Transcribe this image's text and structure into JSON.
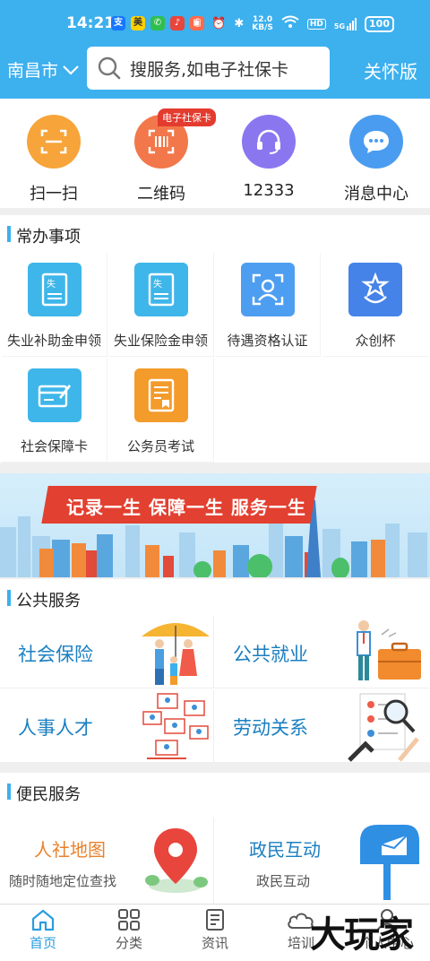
{
  "status_bar": {
    "time": "14:21",
    "speed_value": "12.0",
    "speed_unit": "KB/S",
    "hd": "HD",
    "network": "5G",
    "battery": "100"
  },
  "header": {
    "city": "南昌市",
    "search_placeholder": "搜服务,如电子社保卡",
    "care_mode": "关怀版",
    "accent_color": "#3db0ee"
  },
  "quick_actions": [
    {
      "label": "扫一扫",
      "icon": "scan-icon"
    },
    {
      "label": "二维码",
      "icon": "qrcode-icon",
      "badge": "电子社保卡"
    },
    {
      "label": "12333",
      "icon": "headset-icon"
    },
    {
      "label": "消息中心",
      "icon": "message-icon"
    }
  ],
  "common": {
    "title": "常办事项",
    "items": [
      {
        "label": "失业补助金申领",
        "icon": "unemployment-doc-icon"
      },
      {
        "label": "失业保险金申领",
        "icon": "unemployment-doc-icon"
      },
      {
        "label": "待遇资格认证",
        "icon": "face-verify-icon"
      },
      {
        "label": "众创杯",
        "icon": "trophy-logo-icon"
      },
      {
        "label": "社会保障卡",
        "icon": "social-card-icon"
      },
      {
        "label": "公务员考试",
        "icon": "exam-icon"
      }
    ]
  },
  "banner": {
    "text": "记录一生 保障一生 服务一生"
  },
  "public_services": {
    "title": "公共服务",
    "items": [
      {
        "label": "社会保险"
      },
      {
        "label": "公共就业"
      },
      {
        "label": "人事人才"
      },
      {
        "label": "劳动关系"
      }
    ]
  },
  "convenience": {
    "title": "便民服务",
    "items": [
      {
        "title": "人社地图",
        "subtitle": "随时随地定位查找"
      },
      {
        "title": "政民互动",
        "subtitle": "政民互动"
      }
    ]
  },
  "bottom_nav": [
    {
      "label": "首页",
      "active": true
    },
    {
      "label": "分类"
    },
    {
      "label": "资讯"
    },
    {
      "label": "培训"
    },
    {
      "label": "个人中心"
    }
  ],
  "watermark": "大玩家"
}
